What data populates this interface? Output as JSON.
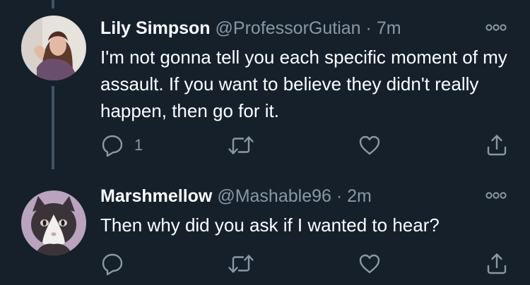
{
  "colors": {
    "background": "#15202b",
    "thread_line": "#3d5466",
    "primary_text": "#ffffff",
    "secondary_text": "#8899a6",
    "icon": "#8899a6"
  },
  "tweets": [
    {
      "display_name": "Lily Simpson",
      "handle": "@ProfessorGutian",
      "separator": "·",
      "time": "7m",
      "text": "I'm not gonna tell you each specific moment of my assault. If you want to believe they didn't really happen, then go for it.",
      "reply_count": "1",
      "icons": [
        "reply-icon",
        "retweet-icon",
        "like-icon",
        "share-icon",
        "more-icon"
      ]
    },
    {
      "display_name": "Marshmellow",
      "handle": "@Mashable96",
      "separator": "·",
      "time": "2m",
      "text": "Then why did you ask if I wanted to hear?",
      "reply_count": "",
      "icons": [
        "reply-icon",
        "retweet-icon",
        "like-icon",
        "share-icon",
        "more-icon"
      ]
    }
  ]
}
